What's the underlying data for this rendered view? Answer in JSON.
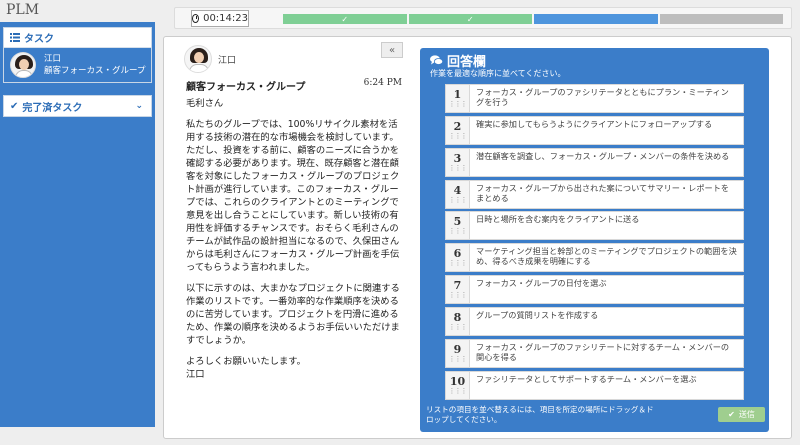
{
  "app": {
    "title": "PLM"
  },
  "timer": {
    "value": "00:14:23"
  },
  "progress": {
    "segments": [
      {
        "status": "done",
        "color": "#7fcf95",
        "mark": "✓"
      },
      {
        "status": "done",
        "color": "#7fcf95",
        "mark": "✓"
      },
      {
        "status": "current",
        "color": "#4e95dd",
        "mark": ""
      },
      {
        "status": "pending",
        "color": "#bdbdbd",
        "mark": ""
      }
    ]
  },
  "sidebar": {
    "tasks_label": "タスク",
    "task": {
      "name": "江口",
      "subtitle": "顧客フォーカス・グループ"
    },
    "completed_label": "完了済タスク"
  },
  "email": {
    "from": "江口",
    "subject": "顧客フォーカス・グループ",
    "time": "6:24 PM",
    "greeting": "毛利さん",
    "p1": "私たちのグループでは、100%リサイクル素材を活用する技術の潜在的な市場機会を検討しています。ただし、投資をする前に、顧客のニーズに合うかを確認する必要があります。現在、既存顧客と潜在顧客を対象にしたフォーカス・グループのプロジェクト計画が進行しています。このフォーカス・グループでは、これらのクライアントとのミーティングで意見を出し合うことにしています。新しい技術の有用性を評価するチャンスです。おそらく毛利さんのチームが試作品の設計担当になるので、久保田さんからは毛利さんにフォーカス・グループ計画を手伝ってもらうよう言われました。",
    "p2": "以下に示すのは、大まかなプロジェクトに関連する作業のリストです。一番効率的な作業順序を決めるのに苦労しています。プロジェクトを円滑に進めるため、作業の順序を決めるようお手伝いいただけますでしょうか。",
    "closing": "よろしくお願いいたします。",
    "signature": "江口",
    "collapse_glyph": "«"
  },
  "answer": {
    "title": "回答欄",
    "subtitle": "作業を最適な順序に並べてください。",
    "items": [
      {
        "num": "1",
        "text": "フォーカス・グループのファシリテータとともにプラン・ミーティングを行う"
      },
      {
        "num": "2",
        "text": "確実に参加してもらうようにクライアントにフォローアップする"
      },
      {
        "num": "3",
        "text": "潜在顧客を調査し、フォーカス・グループ・メンバーの条件を決める"
      },
      {
        "num": "4",
        "text": "フォーカス・グループから出された案についてサマリー・レポートをまとめる"
      },
      {
        "num": "5",
        "text": "日時と場所を含む案内をクライアントに送る"
      },
      {
        "num": "6",
        "text": "マーケティング担当と幹部とのミーティングでプロジェクトの範囲を決め、得るべき成果を明確にする"
      },
      {
        "num": "7",
        "text": "フォーカス・グループの日付を選ぶ"
      },
      {
        "num": "8",
        "text": "グループの質問リストを作成する"
      },
      {
        "num": "9",
        "text": "フォーカス・グループのファシリテートに対するチーム・メンバーの関心を得る"
      },
      {
        "num": "10",
        "text": "ファシリテータとしてサポートするチーム・メンバーを選ぶ"
      }
    ],
    "drag_hint": "⋮⋮⋮",
    "footer": "リストの項目を並べ替えるには、項目を所定の場所にドラッグ＆ドロップしてください。",
    "submit_label": "送信"
  }
}
